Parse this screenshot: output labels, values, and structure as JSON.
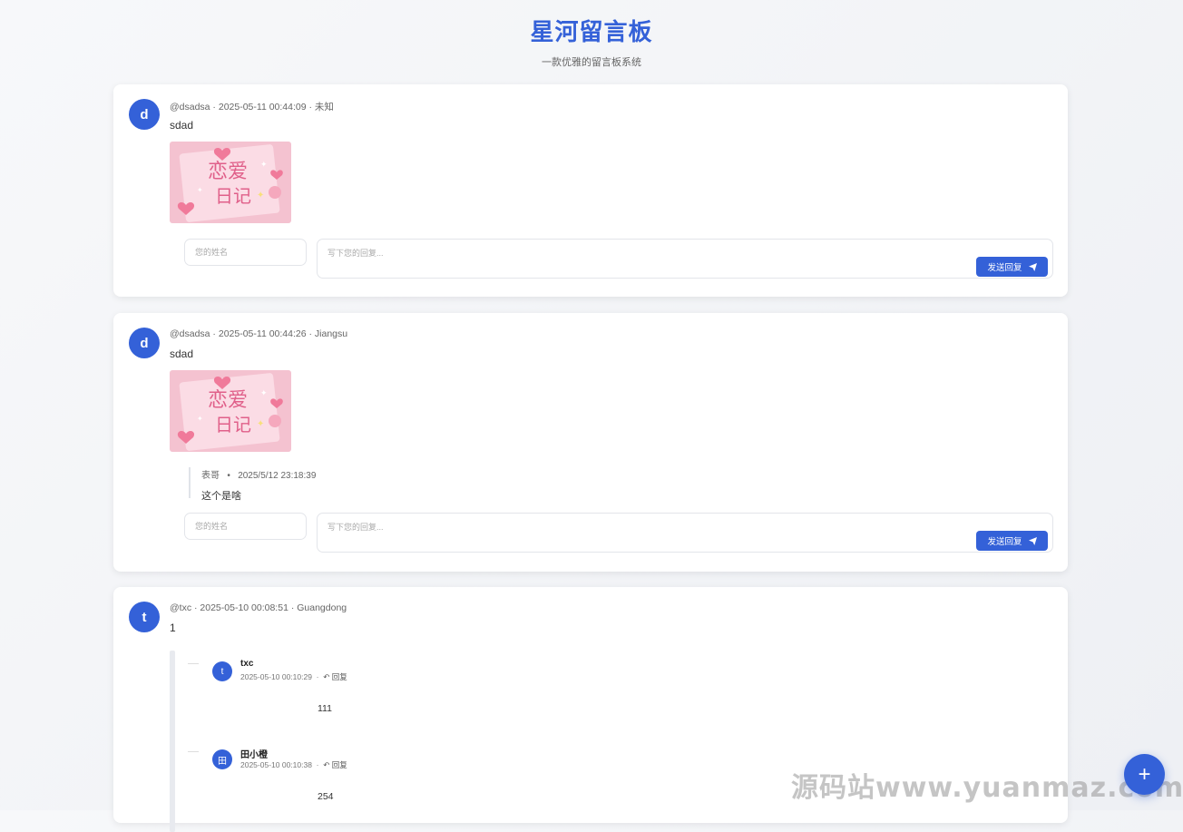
{
  "header": {
    "title": "星河留言板",
    "subtitle": "一款优雅的留言板系统"
  },
  "messages": [
    {
      "avatar": "d",
      "meta": "@dsadsa · 2025-05-11 00:44:09 · 未知",
      "content": "sdad",
      "sticker_lines": [
        "恋爱",
        "日记"
      ],
      "name_placeholder": "您的姓名",
      "reply_placeholder": "写下您的回复...",
      "send_label": "发送回复"
    },
    {
      "avatar": "d",
      "meta": "@dsadsa · 2025-05-11 00:44:26 · Jiangsu",
      "content": "sdad",
      "sticker_lines": [
        "恋爱",
        "日记"
      ],
      "replies": [
        {
          "author": "表哥",
          "time": "2025/5/12 23:18:39",
          "text": "这个是啥"
        }
      ],
      "name_placeholder": "您的姓名",
      "reply_placeholder": "写下您的回复...",
      "send_label": "发送回复"
    },
    {
      "avatar": "t",
      "meta": "@txc · 2025-05-10 00:08:51 · Guangdong",
      "content": "1",
      "nested": [
        {
          "avatar": "t",
          "author": "txc",
          "time": "2025-05-10 00:10:29",
          "reply_label": "回复",
          "text": "111"
        },
        {
          "avatar": "田",
          "author": "田小橙",
          "time": "2025-05-10 00:10:38",
          "reply_label": "回复",
          "text": "254"
        }
      ]
    }
  ],
  "fab": {
    "label": "+"
  },
  "watermark": "源码站www.yuanmaz.com",
  "colors": {
    "accent": "#3461d8",
    "sticker_bg": "#f8c9d6"
  },
  "icons": {
    "send": "paper-plane-icon",
    "reply": "reply-arrow-icon",
    "add": "plus-icon"
  }
}
